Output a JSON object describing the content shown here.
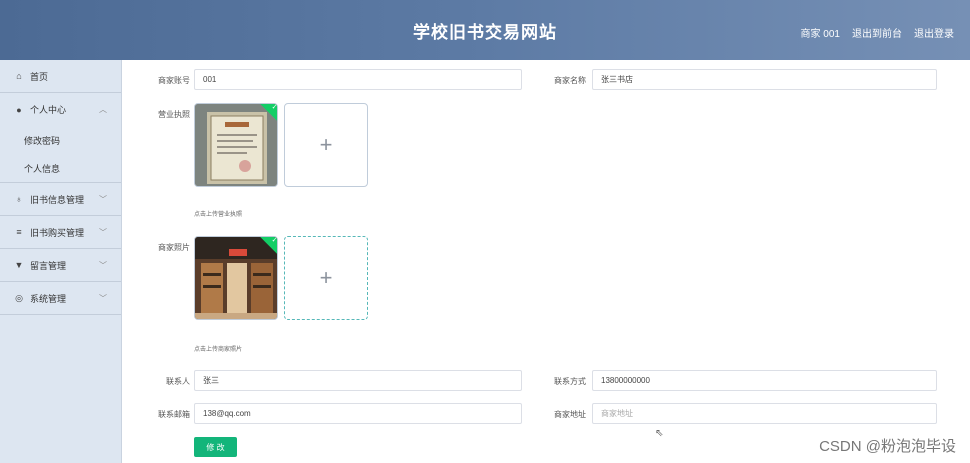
{
  "header": {
    "title": "学校旧书交易网站",
    "user": "商家 001",
    "back_label": "退出到前台",
    "logout_label": "退出登录"
  },
  "sidebar": {
    "home": "首页",
    "personal": "个人中心",
    "change_pwd": "修改密码",
    "personal_info": "个人信息",
    "book_info": "旧书信息管理",
    "book_purchase": "旧书购买管理",
    "message": "留言管理",
    "system": "系统管理"
  },
  "form": {
    "account_label": "商家账号",
    "account_value": "001",
    "name_label": "商家名称",
    "name_value": "张三书店",
    "license_label": "营业执照",
    "license_hint": "点击上传营业执照",
    "photo_label": "商家照片",
    "photo_hint": "点击上传商家照片",
    "contact_label": "联系人",
    "contact_value": "张三",
    "phone_label": "联系方式",
    "phone_value": "13800000000",
    "email_label": "联系邮箱",
    "email_value": "138@qq.com",
    "address_label": "商家地址",
    "address_placeholder": "商家地址",
    "submit_label": "修 改"
  },
  "watermark": "CSDN @粉泡泡毕设",
  "colors": {
    "header": "#5d7ba5",
    "sidebar": "#dde6f1",
    "button": "#13b57a",
    "success": "#13ce66"
  }
}
